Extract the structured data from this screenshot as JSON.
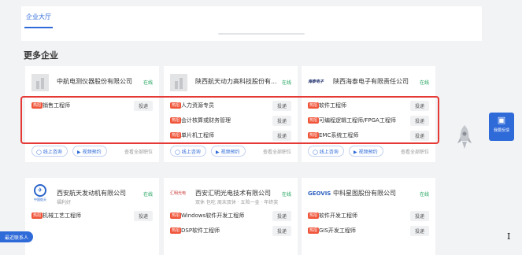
{
  "top_tab": {
    "label": "企业大厅"
  },
  "section_title": "更多企业",
  "common": {
    "online": "在线",
    "hot": "热招",
    "apply": "投递",
    "btn_consult": "线上咨询",
    "btn_video": "视频预约",
    "view_all": "查看全部职位"
  },
  "cards": [
    {
      "name": "中航电测仪器股份有限公司",
      "sub": "",
      "logo_text": "",
      "jobs": [
        {
          "title": "销售工程师"
        }
      ]
    },
    {
      "name": "陕西航天动力高科技股份有...",
      "sub": "",
      "logo_text": "",
      "jobs": [
        {
          "title": "人力资源专员"
        },
        {
          "title": "会计核算或财务管理"
        },
        {
          "title": "单片机工程师"
        }
      ]
    },
    {
      "name": "陕西海泰电子有限责任公司",
      "sub": "",
      "logo_text": "海泰电子",
      "jobs": [
        {
          "title": "软件工程师"
        },
        {
          "title": "可编程逻辑工程师/FPGA工程师"
        },
        {
          "title": "EMC系统工程师"
        }
      ]
    },
    {
      "name": "西安航天发动机有限公司",
      "sub": "福利好",
      "logo_text": "中国航天",
      "jobs": [
        {
          "title": "机械工艺工程师"
        }
      ]
    },
    {
      "name": "西安汇明光电技术有限公司",
      "sub": "双休  包吃 周末双休 · 五险一金 · 年终奖",
      "logo_text": "汇明光电",
      "jobs": [
        {
          "title": "Windows软件开发工程师"
        },
        {
          "title": "DSP软件工程师"
        }
      ]
    },
    {
      "name": "中科星图股份有限公司",
      "sub": "",
      "logo_text": "GEOVIS",
      "jobs": [
        {
          "title": "软件开发工程师"
        },
        {
          "title": "GIS开发工程师"
        }
      ]
    }
  ],
  "feedback": {
    "label": "我要反馈"
  },
  "contact": {
    "label": "最近联系人"
  },
  "colors": {
    "accent": "#2f6ad9",
    "hot": "#f0553a",
    "online": "#18a058",
    "highlight": "#e53935"
  },
  "icons": {
    "consult": "chat-icon",
    "video": "video-icon",
    "feedback": "message-icon",
    "rocket": "rocket-icon"
  }
}
